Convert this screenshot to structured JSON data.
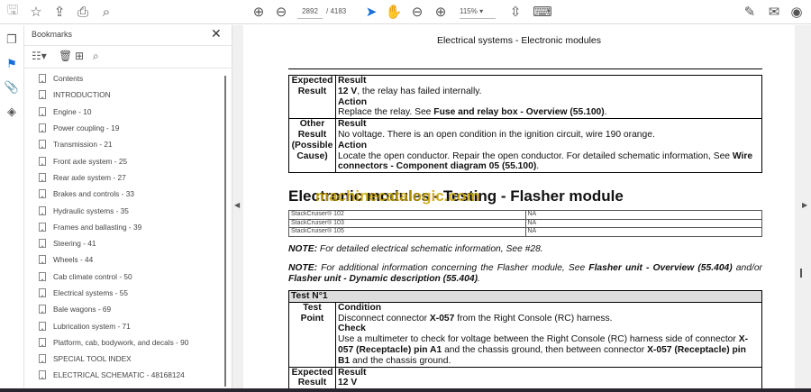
{
  "toolbar": {
    "page_current": "2892",
    "page_total": "/ 4183",
    "zoom": "115%"
  },
  "sidebar": {
    "title": "Bookmarks",
    "close": "✕",
    "items": [
      "Contents",
      "INTRODUCTION",
      "Engine - 10",
      "Power coupling - 19",
      "Transmission - 21",
      "Front axle system - 25",
      "Rear axle system - 27",
      "Brakes and controls - 33",
      "Hydraulic systems - 35",
      "Frames and ballasting - 39",
      "Steering - 41",
      "Wheels - 44",
      "Cab climate control - 50",
      "Electrical systems - 55",
      "Bale wagons - 69",
      "Lubrication system - 71",
      "Platform, cab, bodywork, and decals - 90",
      "SPECIAL TOOL INDEX",
      "ELECTRICAL SCHEMATIC - 48168124"
    ]
  },
  "doc": {
    "header": "Electrical systems - Electronic modules",
    "table1": [
      {
        "label": "Expected Result",
        "lines": [
          [
            {
              "t": "Result",
              "b": true
            }
          ],
          [
            {
              "t": "12 V",
              "b": true
            },
            {
              "t": ", the relay has failed internally."
            }
          ],
          [
            {
              "t": "Action",
              "b": true
            }
          ],
          [
            {
              "t": "Replace the relay.  See "
            },
            {
              "t": "Fuse and relay box - Overview (55.100)",
              "b": true
            },
            {
              "t": "."
            }
          ]
        ]
      },
      {
        "label": "Other Result (Possible Cause)",
        "lines": [
          [
            {
              "t": "Result",
              "b": true
            }
          ],
          [
            {
              "t": "No voltage.  There is an open condition in the ignition circuit, wire 190 orange."
            }
          ],
          [
            {
              "t": "Action",
              "b": true
            }
          ],
          [
            {
              "t": "Locate the open conductor.  Repair the open conductor.  For detailed schematic information, See "
            },
            {
              "t": "Wire connectors - Component diagram 05 (55.100)",
              "b": true
            },
            {
              "t": "."
            }
          ]
        ]
      }
    ],
    "heading": "Electronic modules - Testing - Flasher module",
    "watermark": "machinecatalogic.com",
    "models": [
      [
        "StackCruiser® 102",
        "NA"
      ],
      [
        "StackCruiser® 103",
        "NA"
      ],
      [
        "StackCruiser® 105",
        "NA"
      ]
    ],
    "note1": [
      {
        "t": "NOTE:",
        "b": true
      },
      {
        "t": " For detailed electrical schematic information, See #28."
      }
    ],
    "note2": [
      {
        "t": "NOTE:",
        "b": true
      },
      {
        "t": " For additional information concerning the Flasher module, See "
      },
      {
        "t": "Flasher unit - Overview (55.404)",
        "b": true
      },
      {
        "t": " and/or "
      },
      {
        "t": "Flasher unit - Dynamic description (55.404)",
        "b": true
      },
      {
        "t": "."
      }
    ],
    "test_title": "Test N°1",
    "table2": [
      {
        "label": "Test Point",
        "lines": [
          [
            {
              "t": "Condition",
              "b": true
            }
          ],
          [
            {
              "t": "Disconnect connector "
            },
            {
              "t": "X-057",
              "b": true
            },
            {
              "t": " from the Right Console (RC) harness."
            }
          ],
          [
            {
              "t": "Check",
              "b": true
            }
          ],
          [
            {
              "t": "Use a multimeter to check for voltage between the Right Console (RC) harness side of connector "
            },
            {
              "t": "X-057 (Receptacle) pin A1",
              "b": true
            },
            {
              "t": " and the chassis ground, then between connector "
            },
            {
              "t": "X-057 (Receptacle) pin B1",
              "b": true
            },
            {
              "t": " and the chassis ground."
            }
          ]
        ]
      },
      {
        "label": "Expected Result",
        "lines": [
          [
            {
              "t": "Result",
              "b": true
            }
          ],
          [
            {
              "t": "12 V",
              "b": true
            }
          ]
        ]
      }
    ]
  }
}
